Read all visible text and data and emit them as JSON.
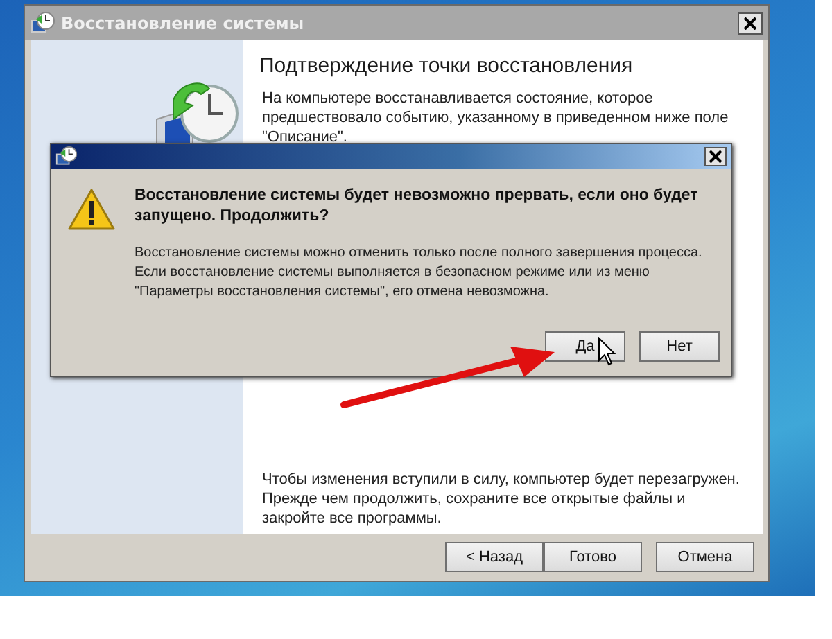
{
  "window": {
    "title": "Восстановление системы",
    "heading": "Подтверждение точки восстановления",
    "description": "На компьютере восстанавливается состояние, которое\nпредшествовало событию, указанному в приведенном ниже поле\n\"Описание\".",
    "note": "Чтобы изменения вступили в силу, компьютер будет перезагружен.\nПрежде чем продолжить, сохраните все открытые файлы и\nзакройте все программы.",
    "buttons": [
      {
        "label": "< Назад"
      },
      {
        "label": "Готово"
      },
      {
        "label": "Отмена"
      }
    ]
  },
  "dialog": {
    "message": "Восстановление системы будет невозможно прервать, если оно будет\nзапущено. Продолжить?",
    "details": "Восстановление системы можно отменить только после полного завершения процесса.\nЕсли восстановление системы выполняется в безопасном режиме или из меню\n\"Параметры восстановления системы\", его отмена невозможна.",
    "buttons": [
      {
        "label": "Да"
      },
      {
        "label": "Нет"
      }
    ]
  }
}
